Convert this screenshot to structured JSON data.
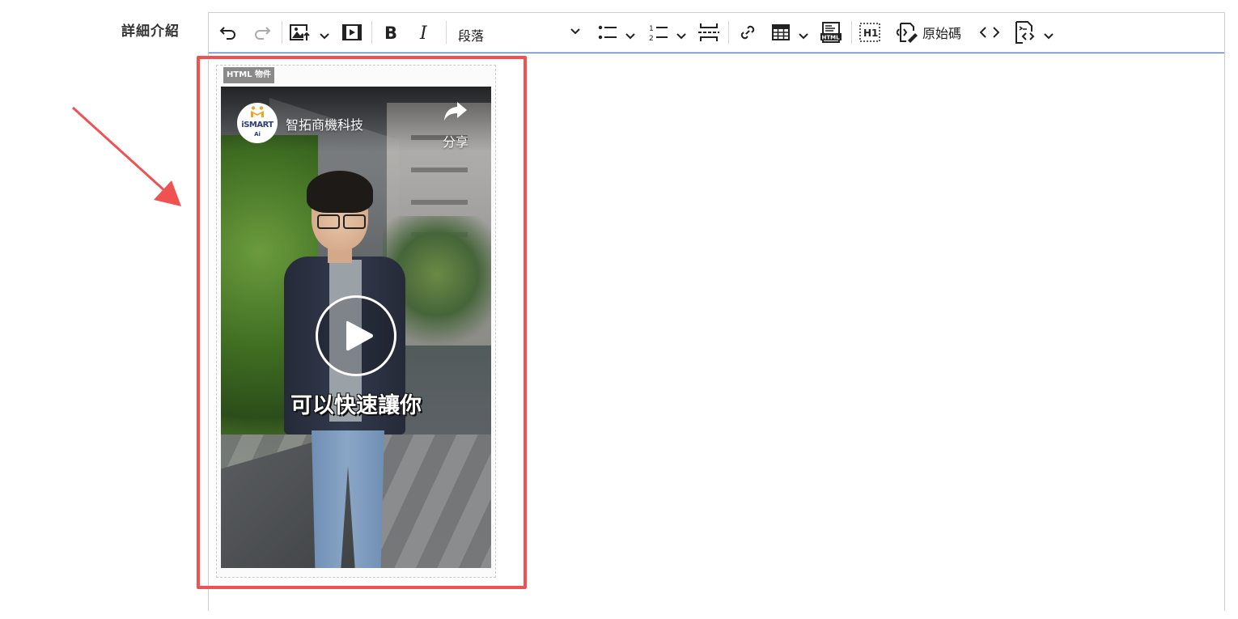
{
  "form": {
    "field_label": "詳細介紹"
  },
  "toolbar": {
    "paragraph_format": "段落",
    "source_label": "原始碼",
    "icons": [
      "undo-icon",
      "redo-icon",
      "image-upload-icon",
      "media-embed-icon",
      "bold-icon",
      "italic-icon",
      "bulleted-list-icon",
      "numbered-list-icon",
      "page-break-icon",
      "link-icon",
      "table-icon",
      "html-embed-icon",
      "heading-h1-icon",
      "source-edit-icon",
      "code-icon",
      "show-blocks-icon"
    ]
  },
  "widget": {
    "badge": "HTML 物件",
    "video": {
      "channel_name": "智拓商機科技",
      "logo_text": "iSMART",
      "logo_sub": "Ai",
      "share_label": "分享",
      "subtitle": "可以快速讓你"
    }
  },
  "colors": {
    "highlight": "#f05252",
    "editor_focus": "#4a7fe0",
    "logo_orange": "#f3a21b"
  }
}
